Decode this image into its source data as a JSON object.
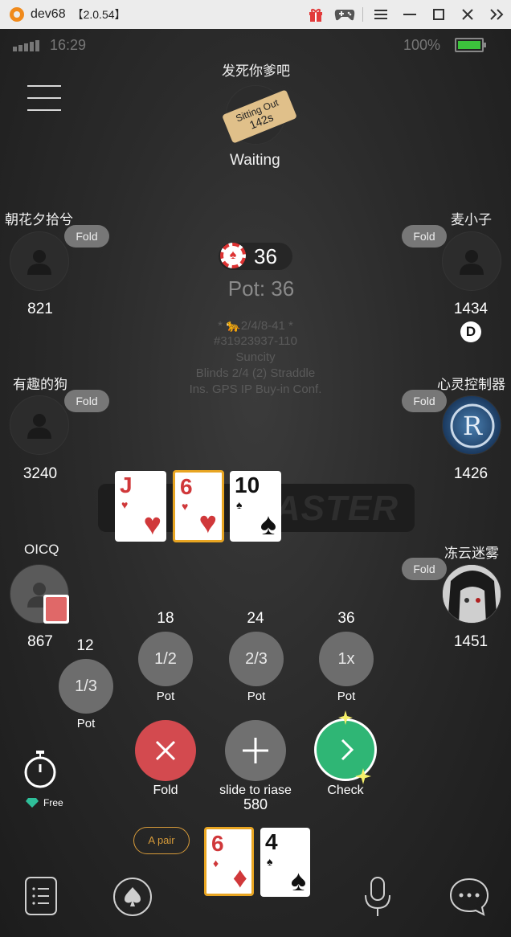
{
  "window": {
    "app_name": "dev68",
    "version": "【2.0.54】",
    "icons": [
      "gift-icon",
      "gamepad-icon",
      "menu-icon",
      "minimize-icon",
      "maximize-icon",
      "close-icon",
      "collapse-icon"
    ]
  },
  "statusbar": {
    "time": "16:29",
    "battery": "100%"
  },
  "top_player": {
    "name": "发死你爹吧",
    "badge_line1": "Sitting Out",
    "badge_line2": "142s",
    "status": "Waiting"
  },
  "seats": {
    "left_top": {
      "name": "朝花夕拾兮",
      "action": "Fold",
      "stack": "821"
    },
    "right_top": {
      "name": "麦小子",
      "action": "Fold",
      "stack": "1434",
      "dealer": "D"
    },
    "left_mid": {
      "name": "有趣的狗",
      "action": "Fold",
      "stack": "3240"
    },
    "right_mid": {
      "name": "心灵控制器",
      "action": "Fold",
      "stack": "1426"
    },
    "left_bottom": {
      "name": "OICQ",
      "stack": "867"
    },
    "right_bottom": {
      "name": "冻云迷雾",
      "action": "Fold",
      "stack": "1451"
    }
  },
  "pot": {
    "chip_amount": "36",
    "label": "Pot: 36"
  },
  "table_info": [
    "* 🐆2/4/8-41 *",
    "#31923937-110",
    "Suncity",
    "Blinds 2/4 (2) Straddle",
    "Ins. GPS IP Buy-in Conf."
  ],
  "watermark": "ASTER",
  "board_cards": [
    {
      "rank": "J",
      "suit": "♥",
      "color": "red"
    },
    {
      "rank": "6",
      "suit": "♥",
      "color": "red"
    },
    {
      "rank": "10",
      "suit": "♠",
      "color": "black"
    }
  ],
  "bet_options": [
    {
      "amount": "12",
      "fraction": "1/3",
      "label": "Pot"
    },
    {
      "amount": "18",
      "fraction": "1/2",
      "label": "Pot"
    },
    {
      "amount": "24",
      "fraction": "2/3",
      "label": "Pot"
    },
    {
      "amount": "36",
      "fraction": "1x",
      "label": "Pot"
    }
  ],
  "actions": {
    "fold": "Fold",
    "raise": "slide to riase",
    "raise_amount": "580",
    "check": "Check"
  },
  "timer": {
    "label": "Free"
  },
  "hand": {
    "hand_label": "A pair",
    "cards": [
      {
        "rank": "6",
        "suit": "♦",
        "color": "red"
      },
      {
        "rank": "4",
        "suit": "♠",
        "color": "black"
      }
    ]
  },
  "bottom_bar": {
    "icons": [
      "list-icon",
      "spade-icon",
      "microphone-icon",
      "chat-icon"
    ]
  }
}
